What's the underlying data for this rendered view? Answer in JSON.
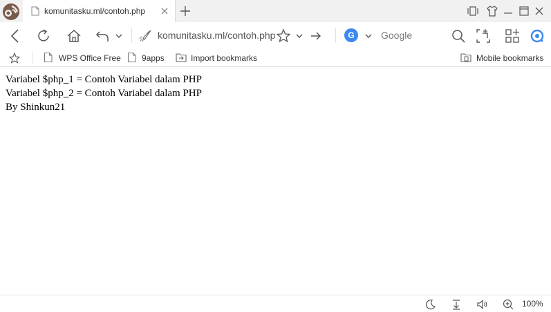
{
  "tab": {
    "title": "komunitasku.ml/contoh.php"
  },
  "address_bar": {
    "url": "komunitasku.ml/contoh.php"
  },
  "search": {
    "engine_icon": "G",
    "placeholder": "Google"
  },
  "bookmarks": [
    {
      "label": "WPS Office Free"
    },
    {
      "label": "9apps"
    },
    {
      "label": "Import bookmarks"
    }
  ],
  "mobile_bookmarks": {
    "label": "Mobile bookmarks"
  },
  "page": {
    "lines": [
      "Variabel $php_1 = Contoh Variabel dalam PHP",
      "Variabel $php_2 = Contoh Variabel dalam PHP",
      "By Shinkun21"
    ]
  },
  "status": {
    "zoom": "100%"
  },
  "colors": {
    "accent": "#3d88f0",
    "tabbar_bg": "#f1f1f1",
    "brand": "#6b4a3a"
  }
}
